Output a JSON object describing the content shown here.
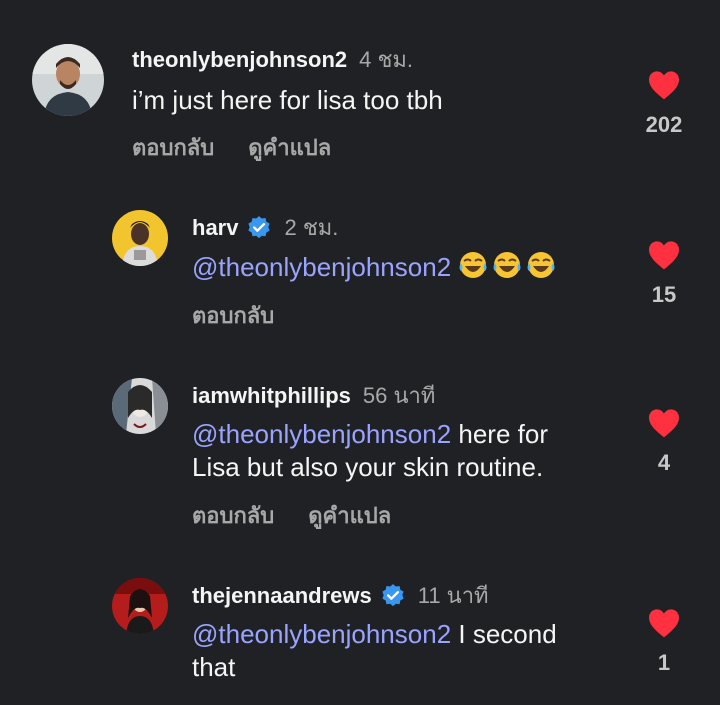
{
  "colors": {
    "background": "#202124",
    "mention": "#9aa4ff",
    "heart": "#ff3040",
    "verified": "#3897f0"
  },
  "comments": [
    {
      "username": "theonlybenjohnson2",
      "time": "4 ชม.",
      "verified": false,
      "text": "i’m just here for lisa too tbh",
      "actions": [
        "ตอบกลับ",
        "ดูคำแปล"
      ],
      "likes": "202"
    },
    {
      "username": "harv",
      "time": "2 ชม.",
      "verified": true,
      "mention": "@theonlybenjohnson2",
      "emoji": [
        "tears-of-joy-emoji",
        "tears-of-joy-emoji",
        "tears-of-joy-emoji"
      ],
      "actions": [
        "ตอบกลับ"
      ],
      "likes": "15"
    },
    {
      "username": "iamwhitphillips",
      "time": "56 นาที",
      "verified": false,
      "mention": "@theonlybenjohnson2",
      "text_line1": " here for",
      "text_line2": "Lisa but also your skin routine.",
      "actions": [
        "ตอบกลับ",
        "ดูคำแปล"
      ],
      "likes": "4"
    },
    {
      "username": "thejennaandrews",
      "time": "11 นาที",
      "verified": true,
      "mention": "@theonlybenjohnson2",
      "text_line1": " I second",
      "text_line2": "that",
      "likes": "1"
    }
  ]
}
